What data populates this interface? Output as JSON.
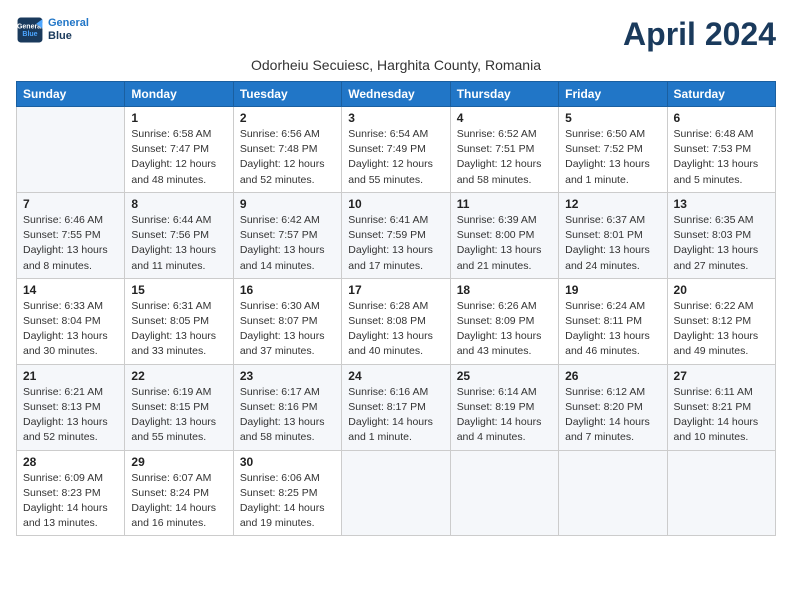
{
  "logo": {
    "line1": "General",
    "line2": "Blue"
  },
  "title": "April 2024",
  "subtitle": "Odorheiu Secuiesc, Harghita County, Romania",
  "weekdays": [
    "Sunday",
    "Monday",
    "Tuesday",
    "Wednesday",
    "Thursday",
    "Friday",
    "Saturday"
  ],
  "weeks": [
    [
      {
        "day": "",
        "info": ""
      },
      {
        "day": "1",
        "info": "Sunrise: 6:58 AM\nSunset: 7:47 PM\nDaylight: 12 hours\nand 48 minutes."
      },
      {
        "day": "2",
        "info": "Sunrise: 6:56 AM\nSunset: 7:48 PM\nDaylight: 12 hours\nand 52 minutes."
      },
      {
        "day": "3",
        "info": "Sunrise: 6:54 AM\nSunset: 7:49 PM\nDaylight: 12 hours\nand 55 minutes."
      },
      {
        "day": "4",
        "info": "Sunrise: 6:52 AM\nSunset: 7:51 PM\nDaylight: 12 hours\nand 58 minutes."
      },
      {
        "day": "5",
        "info": "Sunrise: 6:50 AM\nSunset: 7:52 PM\nDaylight: 13 hours\nand 1 minute."
      },
      {
        "day": "6",
        "info": "Sunrise: 6:48 AM\nSunset: 7:53 PM\nDaylight: 13 hours\nand 5 minutes."
      }
    ],
    [
      {
        "day": "7",
        "info": "Sunrise: 6:46 AM\nSunset: 7:55 PM\nDaylight: 13 hours\nand 8 minutes."
      },
      {
        "day": "8",
        "info": "Sunrise: 6:44 AM\nSunset: 7:56 PM\nDaylight: 13 hours\nand 11 minutes."
      },
      {
        "day": "9",
        "info": "Sunrise: 6:42 AM\nSunset: 7:57 PM\nDaylight: 13 hours\nand 14 minutes."
      },
      {
        "day": "10",
        "info": "Sunrise: 6:41 AM\nSunset: 7:59 PM\nDaylight: 13 hours\nand 17 minutes."
      },
      {
        "day": "11",
        "info": "Sunrise: 6:39 AM\nSunset: 8:00 PM\nDaylight: 13 hours\nand 21 minutes."
      },
      {
        "day": "12",
        "info": "Sunrise: 6:37 AM\nSunset: 8:01 PM\nDaylight: 13 hours\nand 24 minutes."
      },
      {
        "day": "13",
        "info": "Sunrise: 6:35 AM\nSunset: 8:03 PM\nDaylight: 13 hours\nand 27 minutes."
      }
    ],
    [
      {
        "day": "14",
        "info": "Sunrise: 6:33 AM\nSunset: 8:04 PM\nDaylight: 13 hours\nand 30 minutes."
      },
      {
        "day": "15",
        "info": "Sunrise: 6:31 AM\nSunset: 8:05 PM\nDaylight: 13 hours\nand 33 minutes."
      },
      {
        "day": "16",
        "info": "Sunrise: 6:30 AM\nSunset: 8:07 PM\nDaylight: 13 hours\nand 37 minutes."
      },
      {
        "day": "17",
        "info": "Sunrise: 6:28 AM\nSunset: 8:08 PM\nDaylight: 13 hours\nand 40 minutes."
      },
      {
        "day": "18",
        "info": "Sunrise: 6:26 AM\nSunset: 8:09 PM\nDaylight: 13 hours\nand 43 minutes."
      },
      {
        "day": "19",
        "info": "Sunrise: 6:24 AM\nSunset: 8:11 PM\nDaylight: 13 hours\nand 46 minutes."
      },
      {
        "day": "20",
        "info": "Sunrise: 6:22 AM\nSunset: 8:12 PM\nDaylight: 13 hours\nand 49 minutes."
      }
    ],
    [
      {
        "day": "21",
        "info": "Sunrise: 6:21 AM\nSunset: 8:13 PM\nDaylight: 13 hours\nand 52 minutes."
      },
      {
        "day": "22",
        "info": "Sunrise: 6:19 AM\nSunset: 8:15 PM\nDaylight: 13 hours\nand 55 minutes."
      },
      {
        "day": "23",
        "info": "Sunrise: 6:17 AM\nSunset: 8:16 PM\nDaylight: 13 hours\nand 58 minutes."
      },
      {
        "day": "24",
        "info": "Sunrise: 6:16 AM\nSunset: 8:17 PM\nDaylight: 14 hours\nand 1 minute."
      },
      {
        "day": "25",
        "info": "Sunrise: 6:14 AM\nSunset: 8:19 PM\nDaylight: 14 hours\nand 4 minutes."
      },
      {
        "day": "26",
        "info": "Sunrise: 6:12 AM\nSunset: 8:20 PM\nDaylight: 14 hours\nand 7 minutes."
      },
      {
        "day": "27",
        "info": "Sunrise: 6:11 AM\nSunset: 8:21 PM\nDaylight: 14 hours\nand 10 minutes."
      }
    ],
    [
      {
        "day": "28",
        "info": "Sunrise: 6:09 AM\nSunset: 8:23 PM\nDaylight: 14 hours\nand 13 minutes."
      },
      {
        "day": "29",
        "info": "Sunrise: 6:07 AM\nSunset: 8:24 PM\nDaylight: 14 hours\nand 16 minutes."
      },
      {
        "day": "30",
        "info": "Sunrise: 6:06 AM\nSunset: 8:25 PM\nDaylight: 14 hours\nand 19 minutes."
      },
      {
        "day": "",
        "info": ""
      },
      {
        "day": "",
        "info": ""
      },
      {
        "day": "",
        "info": ""
      },
      {
        "day": "",
        "info": ""
      }
    ]
  ]
}
